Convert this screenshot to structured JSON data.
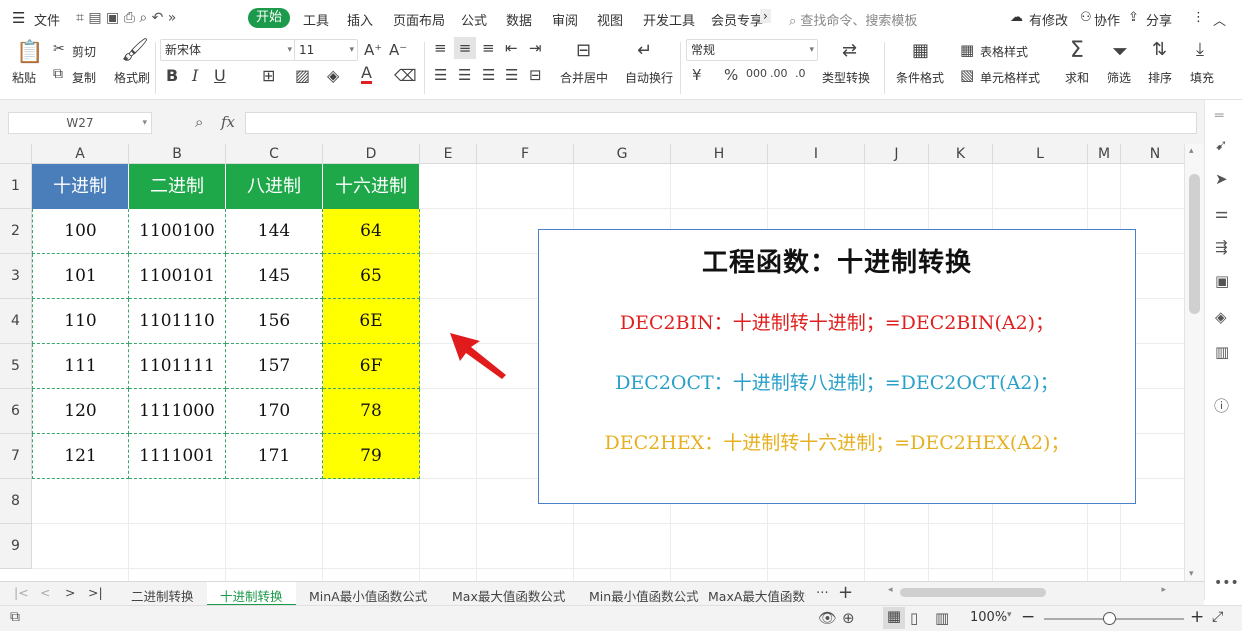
{
  "menu": {
    "file": "文件",
    "start": "开始",
    "items": [
      "工具",
      "插入",
      "页面布局",
      "公式",
      "数据",
      "审阅",
      "视图",
      "开发工具",
      "会员专享"
    ],
    "search_placeholder": "查找命令、搜索模板",
    "right": [
      "有修改",
      "协作",
      "分享"
    ]
  },
  "ribbon": {
    "paste": "粘贴",
    "cut": "剪切",
    "copy": "复制",
    "format_painter": "格式刷",
    "font": "新宋体",
    "font_size": "11",
    "merge": "合并居中",
    "wrap": "自动换行",
    "number_format": "常规",
    "type_convert": "类型转换",
    "cond_format": "条件格式",
    "table_style": "表格样式",
    "cell_style": "单元格样式",
    "sum": "求和",
    "filter": "筛选",
    "sort": "排序",
    "fill": "填充"
  },
  "formula_bar": {
    "name_box": "W27",
    "fx": "fx",
    "value": ""
  },
  "columns": [
    "A",
    "B",
    "C",
    "D",
    "E",
    "F",
    "G",
    "H",
    "I",
    "J",
    "K",
    "L",
    "M",
    "N"
  ],
  "rows": [
    "1",
    "2",
    "3",
    "4",
    "5",
    "6",
    "7",
    "8",
    "9"
  ],
  "table": {
    "headers": [
      "十进制",
      "二进制",
      "八进制",
      "十六进制"
    ],
    "data": [
      [
        "100",
        "1100100",
        "144",
        "64"
      ],
      [
        "101",
        "1100101",
        "145",
        "65"
      ],
      [
        "110",
        "1101110",
        "156",
        "6E"
      ],
      [
        "111",
        "1101111",
        "157",
        "6F"
      ],
      [
        "120",
        "1111000",
        "170",
        "78"
      ],
      [
        "121",
        "1111001",
        "171",
        "79"
      ]
    ]
  },
  "textbox": {
    "title": "工程函数：十进制转换",
    "line1": "DEC2BIN：十进制转十进制；=DEC2BIN(A2)；",
    "line2": "DEC2OCT：十进制转八进制；=DEC2OCT(A2)；",
    "line3": "DEC2HEX：十进制转十六进制；=DEC2HEX(A2)；"
  },
  "sheets": [
    "二进制转换",
    "十进制转换",
    "MinA最小值函数公式",
    "Max最大值函数公式",
    "Min最小值函数公式",
    "MaxA最大值函数公"
  ],
  "active_sheet": "十进制转换",
  "status": {
    "zoom": "100%"
  },
  "colors": {
    "accent": "#1a9a4a",
    "header_blue": "#4a7ebb",
    "header_green": "#1ea84a",
    "hex_yellow": "#ffff00",
    "red_line": "#e0201e",
    "blue_line": "#2aa0c9",
    "gold_line": "#e6b020"
  }
}
